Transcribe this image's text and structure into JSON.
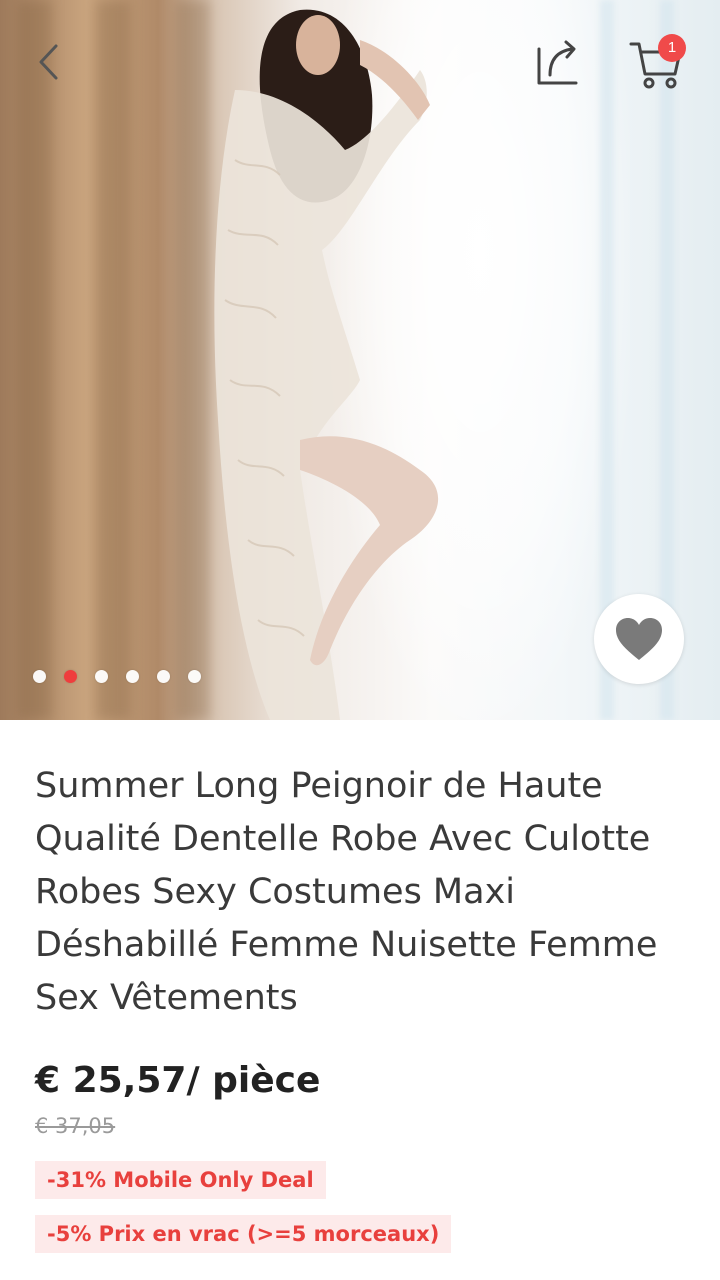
{
  "header": {
    "back_icon": "chevron-left-icon",
    "share_icon": "share-icon",
    "cart_icon": "cart-icon",
    "cart_count": "1"
  },
  "gallery": {
    "total_images": 6,
    "active_index": 1,
    "favorite_icon": "heart-icon"
  },
  "product": {
    "title": "Summer Long Peignoir de Haute Qualité Dentelle Robe Avec Culotte Robes Sexy Costumes Maxi Déshabillé Femme Nuisette Femme Sex Vêtements",
    "price": "€ 25,57/ pièce",
    "original_price": "€ 37,05",
    "deals": [
      "-31% Mobile Only Deal",
      "-5% Prix en vrac (>=5 morceaux)"
    ]
  },
  "colors": {
    "accent": "#ef3d3d",
    "deal_bg": "#fdeaea",
    "deal_text": "#e8403d"
  }
}
